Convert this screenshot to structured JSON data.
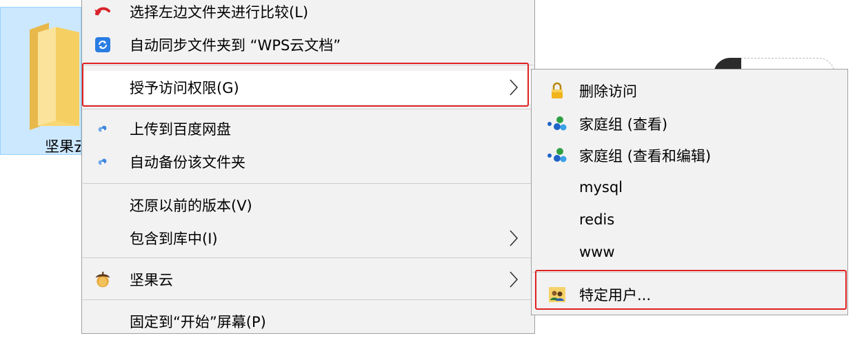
{
  "folder": {
    "label": "坚果云",
    "icon": "folder-icon"
  },
  "menu": {
    "items": [
      {
        "label": "选择左边文件夹进行比较(L)",
        "icon": "undo-arrow-icon"
      },
      {
        "label": "自动同步文件夹到 “WPS云文档”",
        "icon": "wps-cloud-sync-icon"
      },
      {
        "label": "授予访问权限(G)",
        "icon": "",
        "submenu": true,
        "highlighted": true
      },
      {
        "label": "上传到百度网盘",
        "icon": "baidu-netdisk-icon"
      },
      {
        "label": "自动备份该文件夹",
        "icon": "baidu-netdisk-icon"
      },
      {
        "label": "还原以前的版本(V)",
        "icon": ""
      },
      {
        "label": "包含到库中(I)",
        "icon": "",
        "submenu": true
      },
      {
        "label": "坚果云",
        "icon": "acorn-icon",
        "submenu": true
      },
      {
        "label": "固定到“开始”屏幕(P)",
        "icon": ""
      }
    ]
  },
  "submenu": {
    "items": [
      {
        "label": "删除访问",
        "icon": "lock-icon"
      },
      {
        "label": "家庭组 (查看)",
        "icon": "homegroup-icon"
      },
      {
        "label": "家庭组 (查看和编辑)",
        "icon": "homegroup-icon"
      },
      {
        "label": "mysql",
        "icon": ""
      },
      {
        "label": "redis",
        "icon": ""
      },
      {
        "label": "www",
        "icon": ""
      },
      {
        "label": "特定用户...",
        "icon": "users-icon",
        "highlighted": true
      }
    ]
  },
  "colors": {
    "menu_bg": "#f2f2f2",
    "highlight_border": "#e02020",
    "folder_selection": "#cce8ff"
  }
}
